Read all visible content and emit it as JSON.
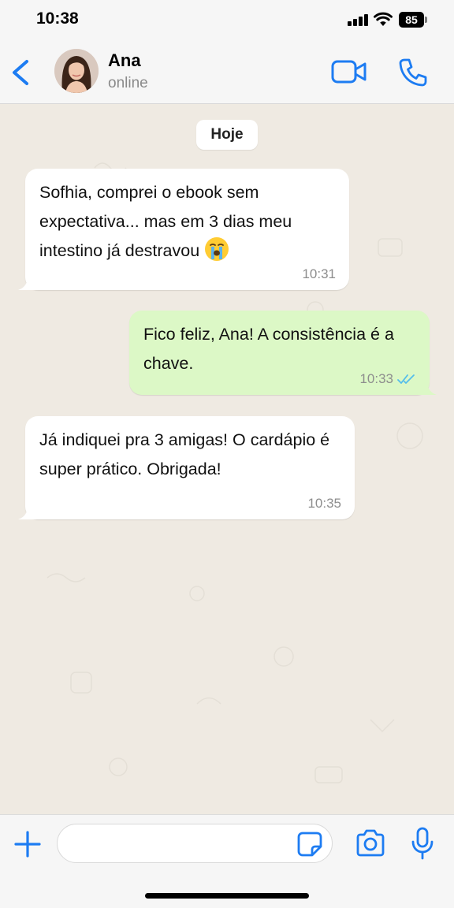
{
  "status_bar": {
    "time": "10:38",
    "battery": "85",
    "icons": [
      "signal-icon",
      "wifi-icon",
      "battery-icon"
    ]
  },
  "header": {
    "contact_name": "Ana",
    "contact_status": "online",
    "icons": {
      "back": "chevron-left-icon",
      "video": "video-camera-icon",
      "call": "phone-icon"
    }
  },
  "chat": {
    "date_label": "Hoje",
    "messages": [
      {
        "direction": "incoming",
        "text": "Sofhia, comprei o ebook sem expectativa... mas em 3 dias meu intestino já destravou",
        "emoji": "crying-face-emoji",
        "time": "10:31"
      },
      {
        "direction": "outgoing",
        "text": "Fico feliz, Ana! A consistência é a chave.",
        "time": "10:33",
        "status": "read"
      },
      {
        "direction": "incoming",
        "text": "Já indiquei pra 3 amigas! O cardápio é super prático. Obrigada!",
        "time": "10:35"
      }
    ]
  },
  "input_bar": {
    "placeholder": "",
    "value": "",
    "icons": [
      "plus-icon",
      "sticker-icon",
      "camera-icon",
      "microphone-icon"
    ]
  },
  "colors": {
    "accent": "#1d7cf2",
    "chat_background": "#efeae2",
    "incoming_bubble": "#ffffff",
    "outgoing_bubble": "#dcf8c6",
    "read_ticks": "#53bdeb"
  }
}
